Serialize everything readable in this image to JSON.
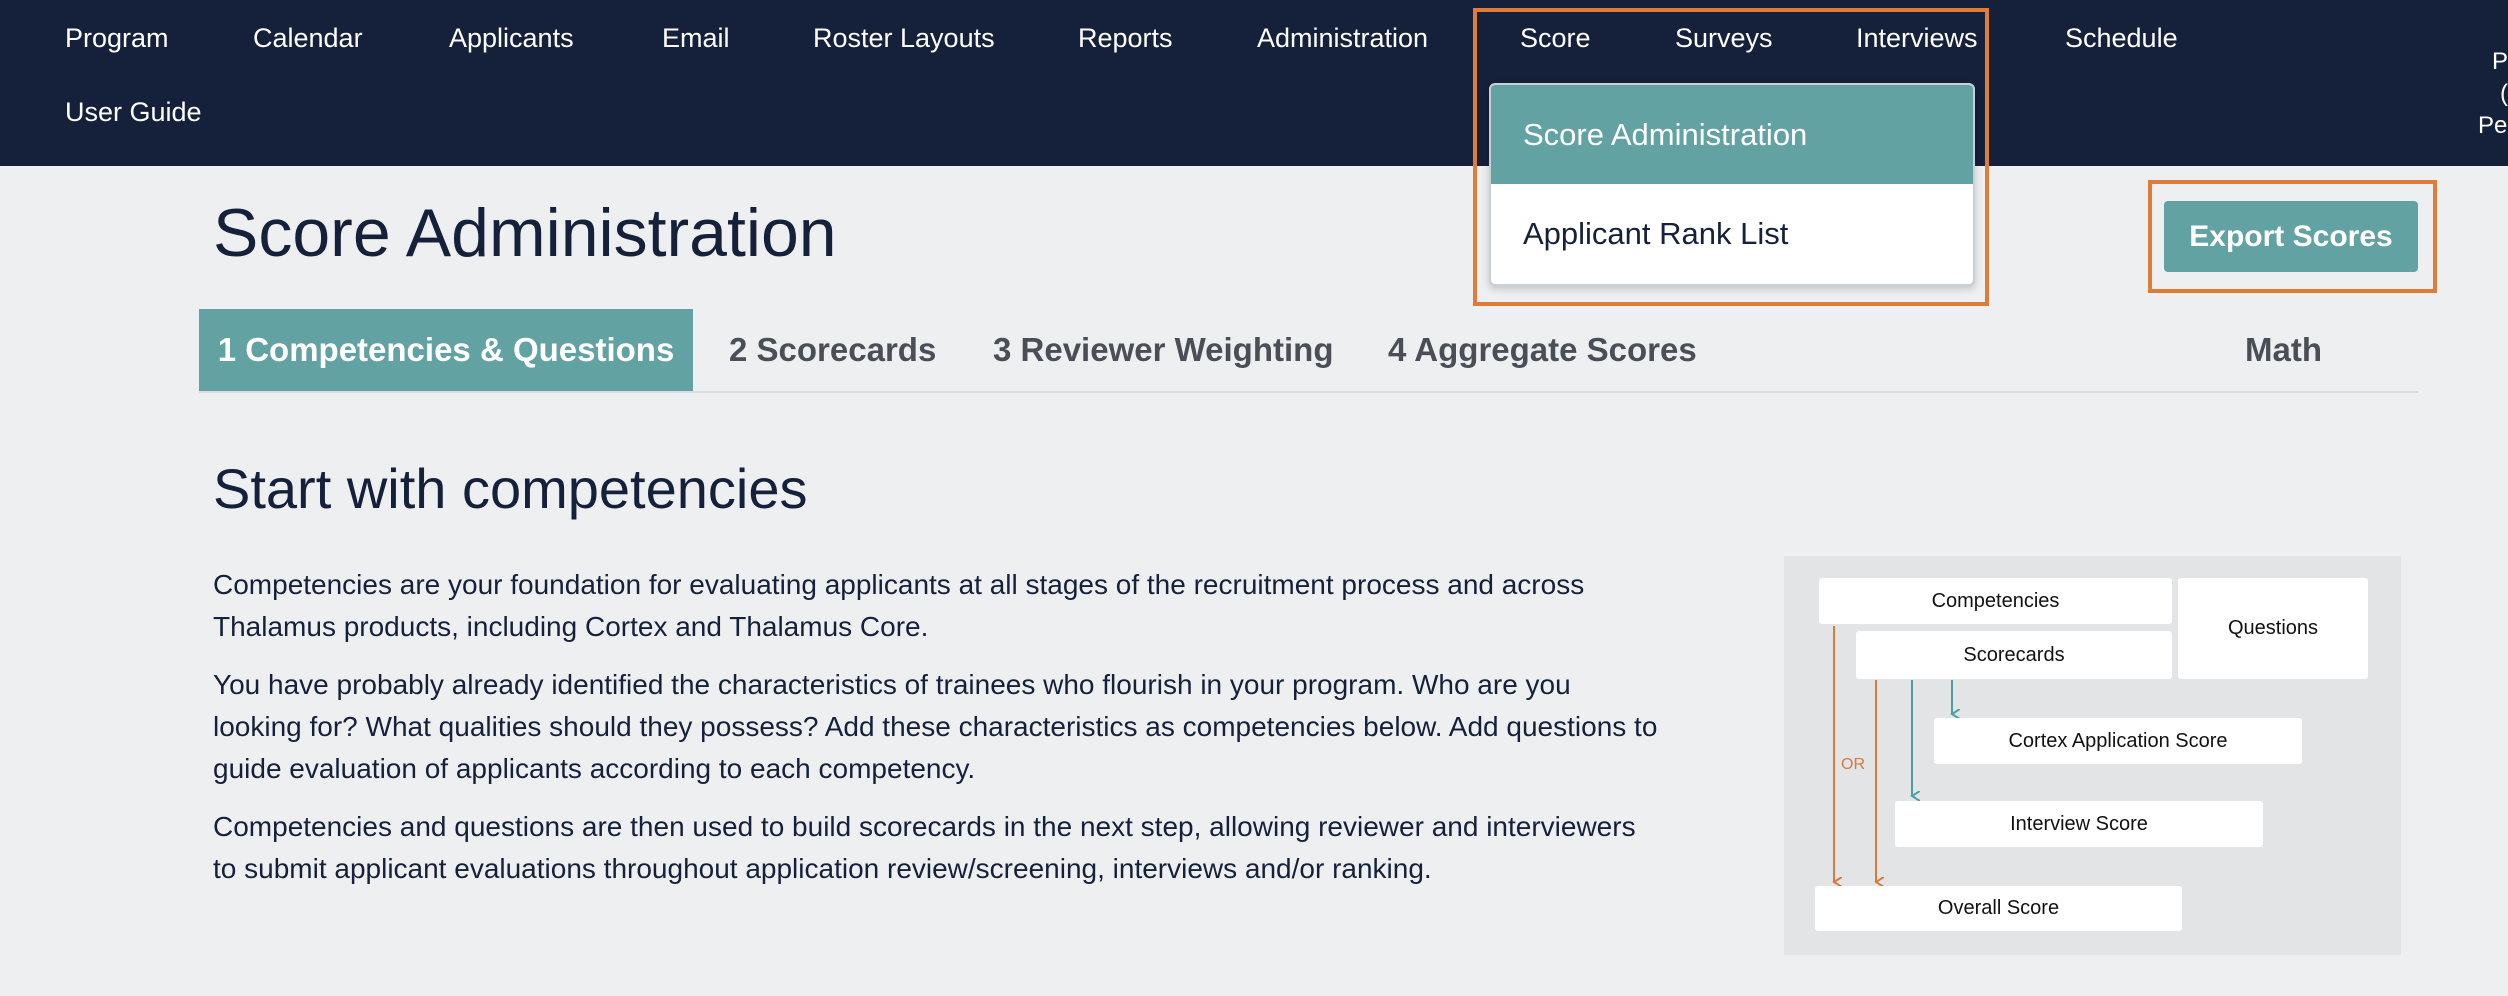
{
  "nav": {
    "items": [
      "Program",
      "Calendar",
      "Applicants",
      "Email",
      "Roster Layouts",
      "Reports",
      "Administration",
      "Score",
      "Surveys",
      "Interviews",
      "Schedule"
    ],
    "user_guide": "User Guide",
    "user_text": [
      "P",
      "(",
      "Pec"
    ]
  },
  "dropdown": {
    "items": [
      "Score Administration",
      "Applicant Rank List"
    ]
  },
  "header": {
    "title": "Score Administration",
    "export_label": "Export Scores"
  },
  "tabs": [
    "1 Competencies & Questions",
    "2 Scorecards",
    "3 Reviewer Weighting",
    "4 Aggregate Scores",
    "Math"
  ],
  "content": {
    "title": "Start with competencies",
    "paragraphs": [
      "Competencies are your foundation for evaluating applicants at all stages of the recruitment process and across Thalamus products, including Cortex and Thalamus Core.",
      "You have probably already identified the characteristics of trainees who flourish in your program. Who are you looking for? What qualities should they possess? Add these characteristics as competencies below. Add questions to guide evaluation of applicants according to each competency.",
      "Competencies and questions are then used to build scorecards in the next step, allowing reviewer and interviewers to submit applicant evaluations throughout application review/screening, interviews and/or ranking."
    ]
  },
  "diagram": {
    "competencies": "Competencies",
    "questions": "Questions",
    "scorecards": "Scorecards",
    "cortex_score": "Cortex Application Score",
    "interview_score": "Interview Score",
    "overall_score": "Overall Score",
    "or_label": "OR"
  },
  "colors": {
    "nav_bg": "#15213a",
    "accent": "#63a2a2",
    "highlight": "#e07b39",
    "page_bg": "#eeeff1",
    "arrow_orange": "#d87a3c",
    "arrow_teal": "#4e9ea3"
  }
}
